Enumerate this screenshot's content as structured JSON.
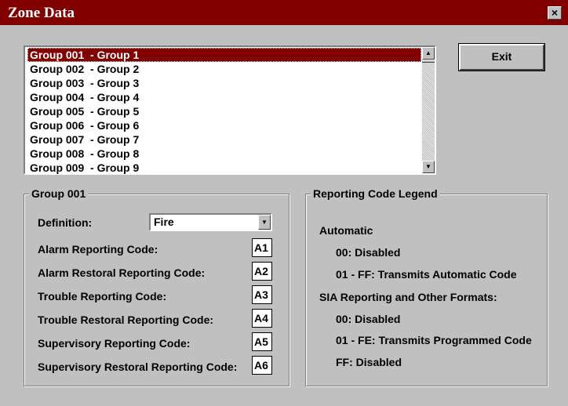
{
  "window": {
    "title": "Zone Data",
    "close_label": "×"
  },
  "list": {
    "items": [
      "Group 001  - Group 1",
      "Group 002  - Group 2",
      "Group 003  - Group 3",
      "Group 004  - Group 4",
      "Group 005  - Group 5",
      "Group 006  - Group 6",
      "Group 007  - Group 7",
      "Group 008  - Group 8",
      "Group 009  - Group 9"
    ],
    "selected_index": 0
  },
  "buttons": {
    "exit": "Exit"
  },
  "group": {
    "title": "Group 001",
    "definition_label": "Definition:",
    "definition_value": "Fire",
    "codes": [
      {
        "label": "Alarm Reporting Code:",
        "value": "A1"
      },
      {
        "label": "Alarm Restoral Reporting Code:",
        "value": "A2"
      },
      {
        "label": "Trouble Reporting Code:",
        "value": "A3"
      },
      {
        "label": "Trouble Restoral Reporting Code:",
        "value": "A4"
      },
      {
        "label": "Supervisory Reporting Code:",
        "value": "A5"
      },
      {
        "label": "Supervisory Restoral Reporting Code:",
        "value": "A6"
      }
    ]
  },
  "legend": {
    "title": "Reporting Code Legend",
    "automatic_heading": "Automatic",
    "automatic_lines": [
      "00: Disabled",
      "01 - FF: Transmits Automatic Code"
    ],
    "sia_heading": "SIA Reporting and Other Formats:",
    "sia_lines": [
      "00: Disabled",
      "01 - FE: Transmits Programmed Code",
      "FF: Disabled"
    ]
  },
  "colors": {
    "title_bar": "#800000",
    "face": "#c0c0c0",
    "selection": "#800000"
  },
  "icons": {
    "scroll_up": "scroll-up-arrow-icon",
    "scroll_down": "scroll-down-arrow-icon",
    "dropdown": "chevron-down-icon",
    "close": "close-icon"
  }
}
